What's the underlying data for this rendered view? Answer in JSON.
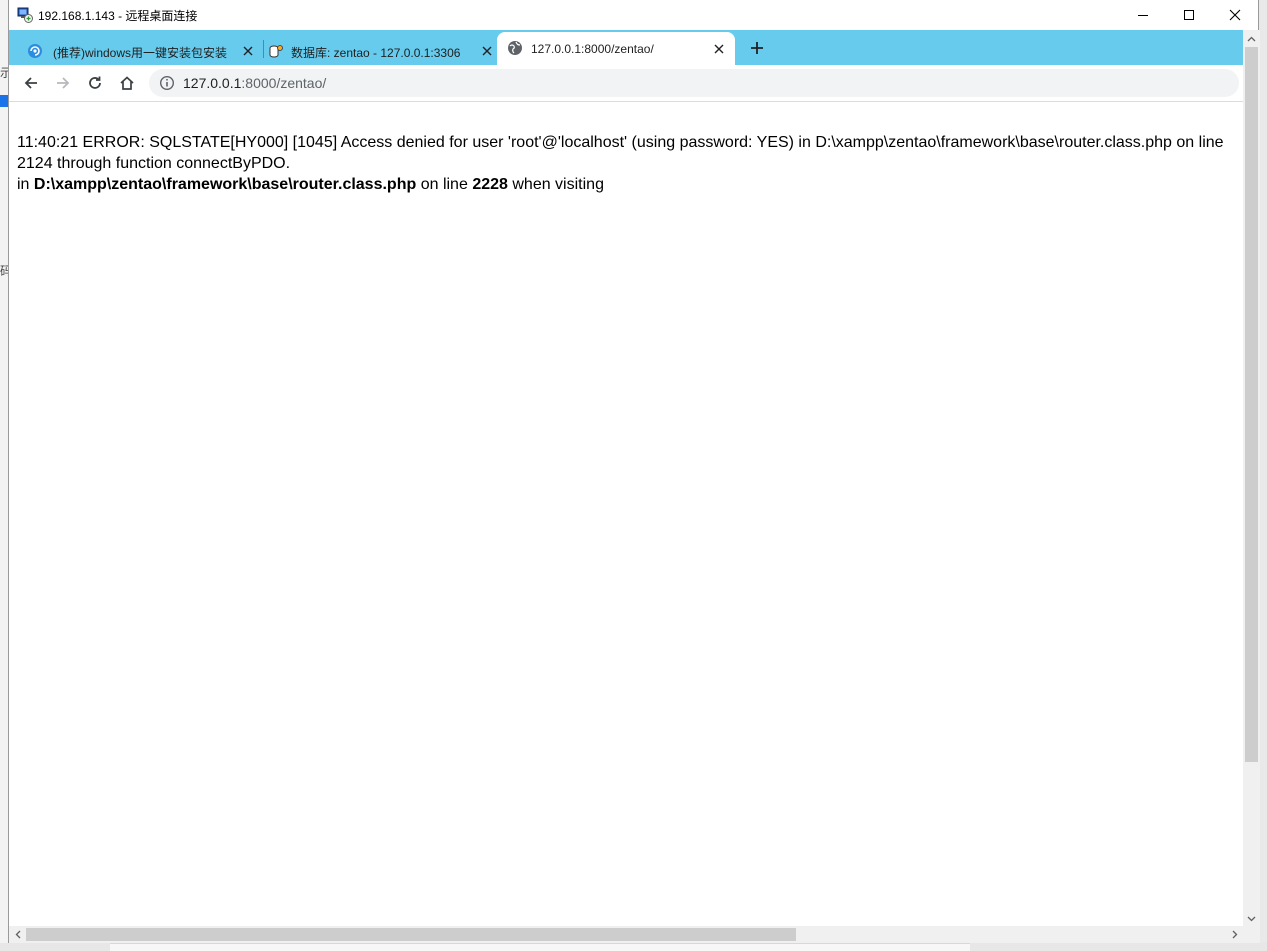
{
  "window": {
    "title": "192.168.1.143 - 远程桌面连接"
  },
  "tabs": [
    {
      "title": "(推荐)windows用一键安装包安装",
      "icon": "zentao-swirl-icon",
      "active": false
    },
    {
      "title": "数据库: zentao - 127.0.0.1:3306",
      "icon": "database-icon",
      "active": false
    },
    {
      "title": "127.0.0.1:8000/zentao/",
      "icon": "globe-icon",
      "active": true
    }
  ],
  "toolbar": {
    "url_host": "127.0.0.1",
    "url_rest": ":8000/zentao/"
  },
  "error": {
    "line1": "11:40:21 ERROR: SQLSTATE[HY000] [1045] Access denied for user 'root'@'localhost' (using password: YES) in D:\\xampp\\zentao\\framework\\base\\router.class.php on line",
    "line2": "2124 through function connectByPDO.",
    "in_label": "in",
    "file": "D:\\xampp\\zentao\\framework\\base\\router.class.php",
    "on_line_label": "on line",
    "line_number": "2228",
    "tail": "when visiting"
  },
  "colors": {
    "tab_strip": "#67cbed",
    "active_tab": "#ffffff",
    "omnibox": "#f1f3f4"
  }
}
